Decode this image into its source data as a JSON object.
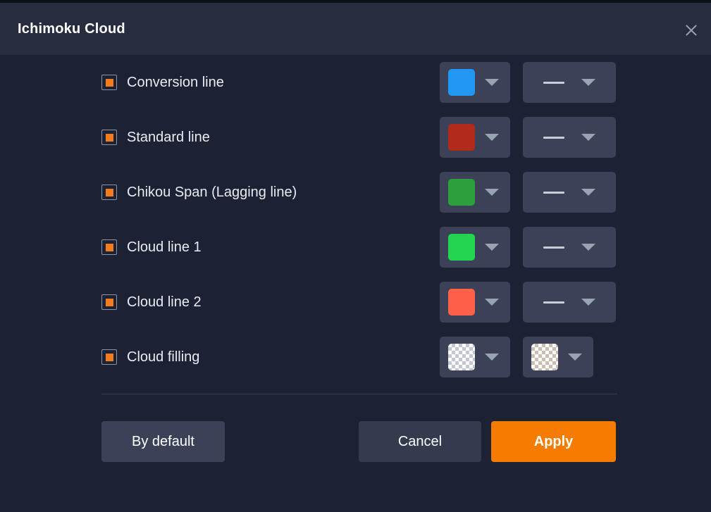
{
  "window": {
    "title": "Ichimoku Cloud",
    "close_icon": "close-icon"
  },
  "colors": {
    "header_bg": "#272d3f",
    "body_bg": "#1c2233",
    "control_bg": "#3b4257",
    "accent_orange": "#f57c00",
    "checkbox_mark": "#f57c1e",
    "text": "#e9ecf2",
    "caret": "#9aa2b4",
    "divider": "#343b4f"
  },
  "rows": [
    {
      "label": "Conversion line",
      "checked": true,
      "color": "#2196f3",
      "color_swatch_kind": "solid",
      "line_style": "solid",
      "has_line_style": true,
      "second_swatch_kind": null,
      "second_color": null
    },
    {
      "label": "Standard line",
      "checked": true,
      "color": "#b22a1c",
      "color_swatch_kind": "solid",
      "line_style": "solid",
      "has_line_style": true,
      "second_swatch_kind": null,
      "second_color": null
    },
    {
      "label": "Chikou Span (Lagging line)",
      "checked": true,
      "color": "#2ba03c",
      "color_swatch_kind": "solid",
      "line_style": "solid",
      "has_line_style": true,
      "second_swatch_kind": null,
      "second_color": null
    },
    {
      "label": "Cloud line 1",
      "checked": true,
      "color": "#22d44f",
      "color_swatch_kind": "solid",
      "line_style": "solid",
      "has_line_style": true,
      "second_swatch_kind": null,
      "second_color": null
    },
    {
      "label": "Cloud line 2",
      "checked": true,
      "color": "#ff604a",
      "color_swatch_kind": "solid",
      "line_style": "solid",
      "has_line_style": true,
      "second_swatch_kind": null,
      "second_color": null
    },
    {
      "label": "Cloud filling",
      "checked": true,
      "color": null,
      "color_swatch_kind": "checker",
      "line_style": null,
      "has_line_style": false,
      "second_swatch_kind": "checker-warm",
      "second_color": null
    }
  ],
  "footer": {
    "by_default_label": "By default",
    "cancel_label": "Cancel",
    "apply_label": "Apply"
  }
}
